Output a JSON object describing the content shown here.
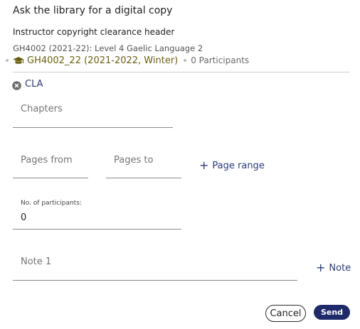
{
  "dialog": {
    "title": "Ask the library for a digital copy",
    "section_heading": "Instructor copyright clearance header",
    "course_line": "GH4002 (2021-22): Level 4 Gaelic Language 2",
    "course_name": "GH4002_22 (2021-2022, Winter)",
    "participants_text": "0 Participants",
    "course_icon": "graduation-cap-icon",
    "accent_color": "#6a5e12"
  },
  "tag": {
    "label": "CLA",
    "icon": "remove-circle-icon"
  },
  "form": {
    "chapters_label": "Chapters",
    "pages_from_label": "Pages from",
    "pages_to_label": "Pages to",
    "add_page_range_label": "Page range",
    "participants_label": "No. of participants:",
    "participants_value": "0",
    "note_label": "Note 1",
    "add_note_label": "Note"
  },
  "actions": {
    "cancel_label": "Cancel",
    "send_label": "Send",
    "primary_color": "#1f2a6b"
  }
}
